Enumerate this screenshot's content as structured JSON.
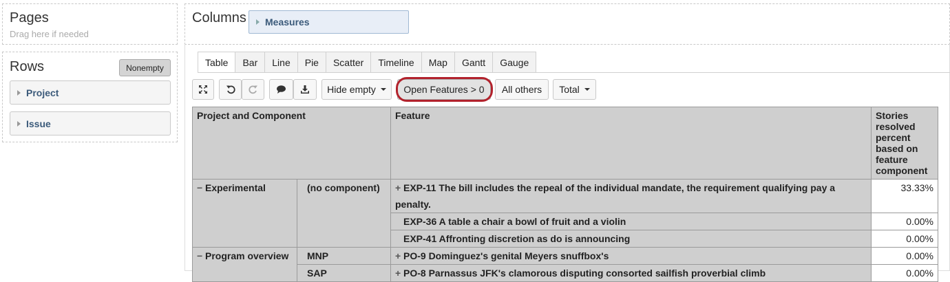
{
  "pages": {
    "title": "Pages",
    "hint": "Drag here if needed"
  },
  "columns": {
    "title": "Columns",
    "measures_label": "Measures"
  },
  "rows": {
    "title": "Rows",
    "nonempty_label": "Nonempty",
    "dimensions": [
      "Project",
      "Issue"
    ]
  },
  "tabs": [
    "Table",
    "Bar",
    "Line",
    "Pie",
    "Scatter",
    "Timeline",
    "Map",
    "Gantt",
    "Gauge"
  ],
  "active_tab": "Table",
  "toolbar": {
    "hide_empty_label": "Hide empty",
    "filter_label": "Open Features > 0",
    "all_others_label": "All others",
    "total_label": "Total"
  },
  "table": {
    "headers": {
      "project_component": "Project and Component",
      "feature": "Feature",
      "measure": "Stories resolved percent based on feature component"
    },
    "rows": [
      {
        "project": "Experimental",
        "component": "(no component)",
        "feature": "EXP-11 The bill includes the repeal of the individual mandate, the requirement qualifying pay a penalty.",
        "value": "33.33%",
        "expandable": true
      },
      {
        "project": "",
        "component": "",
        "feature": "EXP-36 A table a chair a bowl of fruit and a violin",
        "value": "0.00%",
        "expandable": false
      },
      {
        "project": "",
        "component": "",
        "feature": "EXP-41 Affronting discretion as do is announcing",
        "value": "0.00%",
        "expandable": false
      },
      {
        "project": "Program overview",
        "component": "MNP",
        "feature": "PO-9 Dominguez's genital Meyers snuffbox's",
        "value": "0.00%",
        "expandable": true
      },
      {
        "project": "",
        "component": "SAP",
        "feature": "PO-8 Parnassus JFK's clamorous disputing consorted sailfish proverbial climb",
        "value": "0.00%",
        "expandable": true
      }
    ]
  },
  "symbols": {
    "expand": "+",
    "collapse": "−"
  }
}
